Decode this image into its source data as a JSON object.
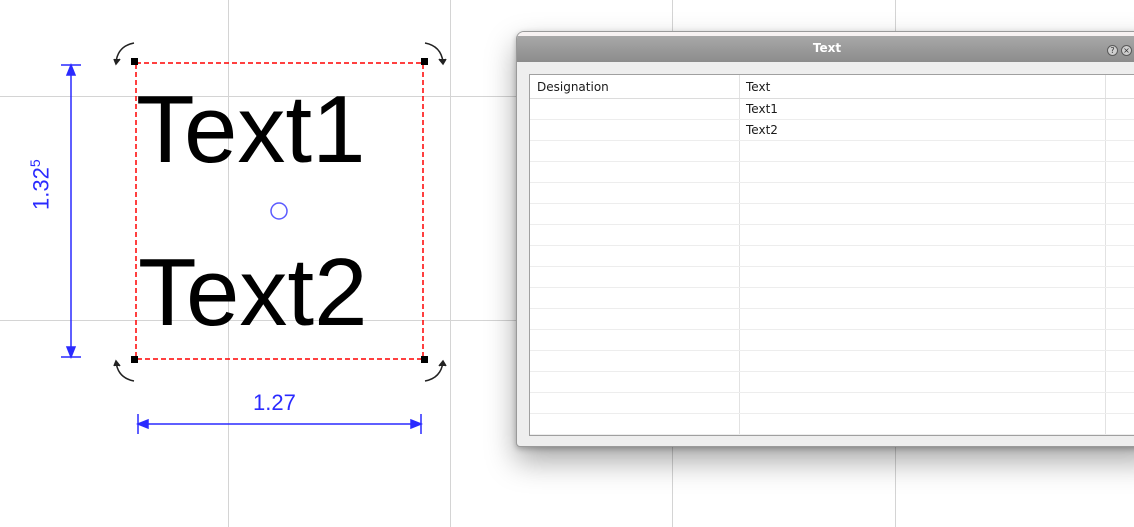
{
  "canvas": {
    "text_objects": [
      "Text1",
      "Text2"
    ],
    "dimension_height": {
      "value": "1.32",
      "superscript": "5"
    },
    "dimension_width": "1.27",
    "colors": {
      "dimension": "#2a2aff",
      "selection": "#ff0000",
      "grid": "#d4d4d4",
      "text": "#000000"
    },
    "icons": [
      "rotate-handle-icon",
      "center-point-icon",
      "resize-handle-icon"
    ]
  },
  "dialog": {
    "title": "Text",
    "title_icons": [
      "help-icon",
      "close-icon"
    ],
    "table": {
      "columns": [
        "Designation",
        "Text"
      ],
      "rows": [
        {
          "designation": "",
          "text": "Text1"
        },
        {
          "designation": "",
          "text": "Text2"
        }
      ]
    }
  }
}
